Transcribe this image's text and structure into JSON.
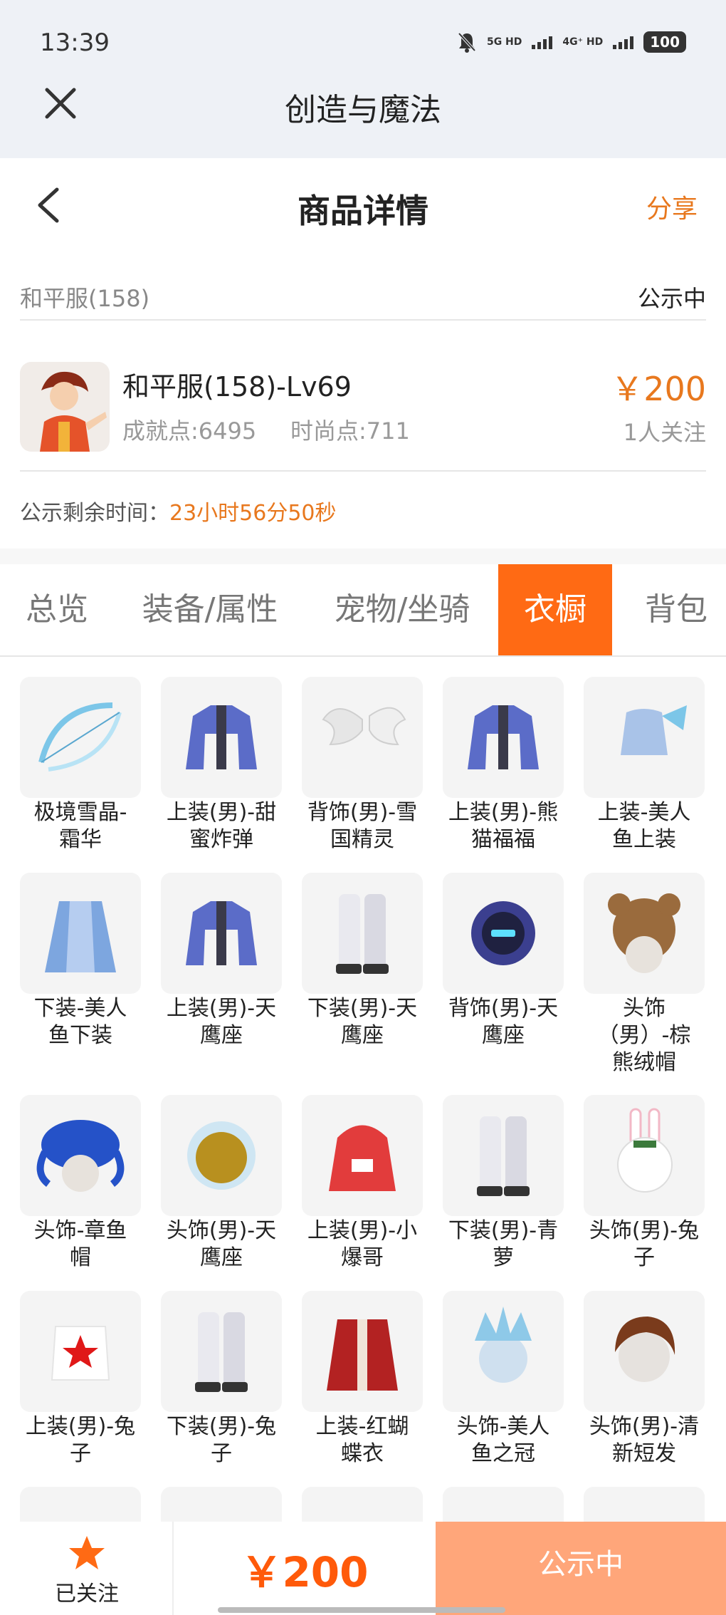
{
  "status_bar": {
    "time": "13:39",
    "network1": "5G HD",
    "network2": "4G⁺ HD",
    "battery": "100"
  },
  "app_bar": {
    "title": "创造与魔法"
  },
  "nav": {
    "title": "商品详情",
    "share": "分享"
  },
  "account": {
    "name": "和平服(158)",
    "status": "公示中"
  },
  "product": {
    "title": "和平服(158)-Lv69",
    "achievement": "成就点:6495",
    "fashion": "时尚点:711",
    "price": "￥200",
    "followers": "1人关注"
  },
  "countdown": {
    "label": "公示剩余时间：",
    "value": "23小时56分50秒"
  },
  "tabs": [
    {
      "label": "总览",
      "active": false
    },
    {
      "label": "装备/属性",
      "active": false
    },
    {
      "label": "宠物/坐骑",
      "active": false
    },
    {
      "label": "衣橱",
      "active": true
    },
    {
      "label": "背包",
      "active": false
    }
  ],
  "wardrobe": [
    {
      "name": "极境雪晶-霜华",
      "lines": [
        "极境雪晶-",
        "霜华"
      ],
      "icon": "bow-icon"
    },
    {
      "name": "上装(男)-甜蜜炸弹",
      "lines": [
        "上装(男)-甜",
        "蜜炸弹"
      ],
      "icon": "jacket-icon"
    },
    {
      "name": "背饰(男)-雪国精灵",
      "lines": [
        "背饰(男)-雪",
        "国精灵"
      ],
      "icon": "wings-icon"
    },
    {
      "name": "上装(男)-熊猫福福",
      "lines": [
        "上装(男)-熊",
        "猫福福"
      ],
      "icon": "jacket-icon"
    },
    {
      "name": "上装-美人鱼上装",
      "lines": [
        "上装-美人",
        "鱼上装"
      ],
      "icon": "top-icon"
    },
    {
      "name": "下装-美人鱼下装",
      "lines": [
        "下装-美人",
        "鱼下装"
      ],
      "icon": "skirt-icon"
    },
    {
      "name": "上装(男)-天鹰座",
      "lines": [
        "上装(男)-天",
        "鹰座"
      ],
      "icon": "jacket-icon"
    },
    {
      "name": "下装(男)-天鹰座",
      "lines": [
        "下装(男)-天",
        "鹰座"
      ],
      "icon": "pants-icon"
    },
    {
      "name": "背饰(男)-天鹰座",
      "lines": [
        "背饰(男)-天",
        "鹰座"
      ],
      "icon": "backpack-icon"
    },
    {
      "name": "头饰（男）-棕熊绒帽",
      "lines": [
        "头饰",
        "（男）-棕",
        "熊绒帽"
      ],
      "icon": "bear-hat-icon"
    },
    {
      "name": "头饰-章鱼帽",
      "lines": [
        "头饰-章鱼",
        "帽"
      ],
      "icon": "octopus-hat-icon"
    },
    {
      "name": "头饰(男)-天鹰座",
      "lines": [
        "头饰(男)-天",
        "鹰座"
      ],
      "icon": "helmet-icon"
    },
    {
      "name": "上装(男)-小爆哥",
      "lines": [
        "上装(男)-小",
        "爆哥"
      ],
      "icon": "hoodie-icon"
    },
    {
      "name": "下装(男)-青萝",
      "lines": [
        "下装(男)-青",
        "萝"
      ],
      "icon": "pants-icon"
    },
    {
      "name": "头饰(男)-兔子",
      "lines": [
        "头饰(男)-兔",
        "子"
      ],
      "icon": "bunny-hat-icon"
    },
    {
      "name": "上装(男)-兔子",
      "lines": [
        "上装(男)-兔",
        "子"
      ],
      "icon": "star-shirt-icon"
    },
    {
      "name": "下装(男)-兔子",
      "lines": [
        "下装(男)-兔",
        "子"
      ],
      "icon": "pants-icon"
    },
    {
      "name": "上装-红蝴蝶衣",
      "lines": [
        "上装-红蝴",
        "蝶衣"
      ],
      "icon": "coat-icon"
    },
    {
      "name": "头饰-美人鱼之冠",
      "lines": [
        "头饰-美人",
        "鱼之冠"
      ],
      "icon": "crown-icon"
    },
    {
      "name": "头饰(男)-清新短发",
      "lines": [
        "头饰(男)-清",
        "新短发"
      ],
      "icon": "hair-icon"
    }
  ],
  "colors": {
    "accent": "#ff6a14",
    "orange_text": "#e8781e",
    "price_bottom": "#ff5a0a",
    "action_bg": "#ffa67a"
  },
  "bottom_bar": {
    "follow_label": "已关注",
    "price": "￥200",
    "action": "公示中"
  }
}
